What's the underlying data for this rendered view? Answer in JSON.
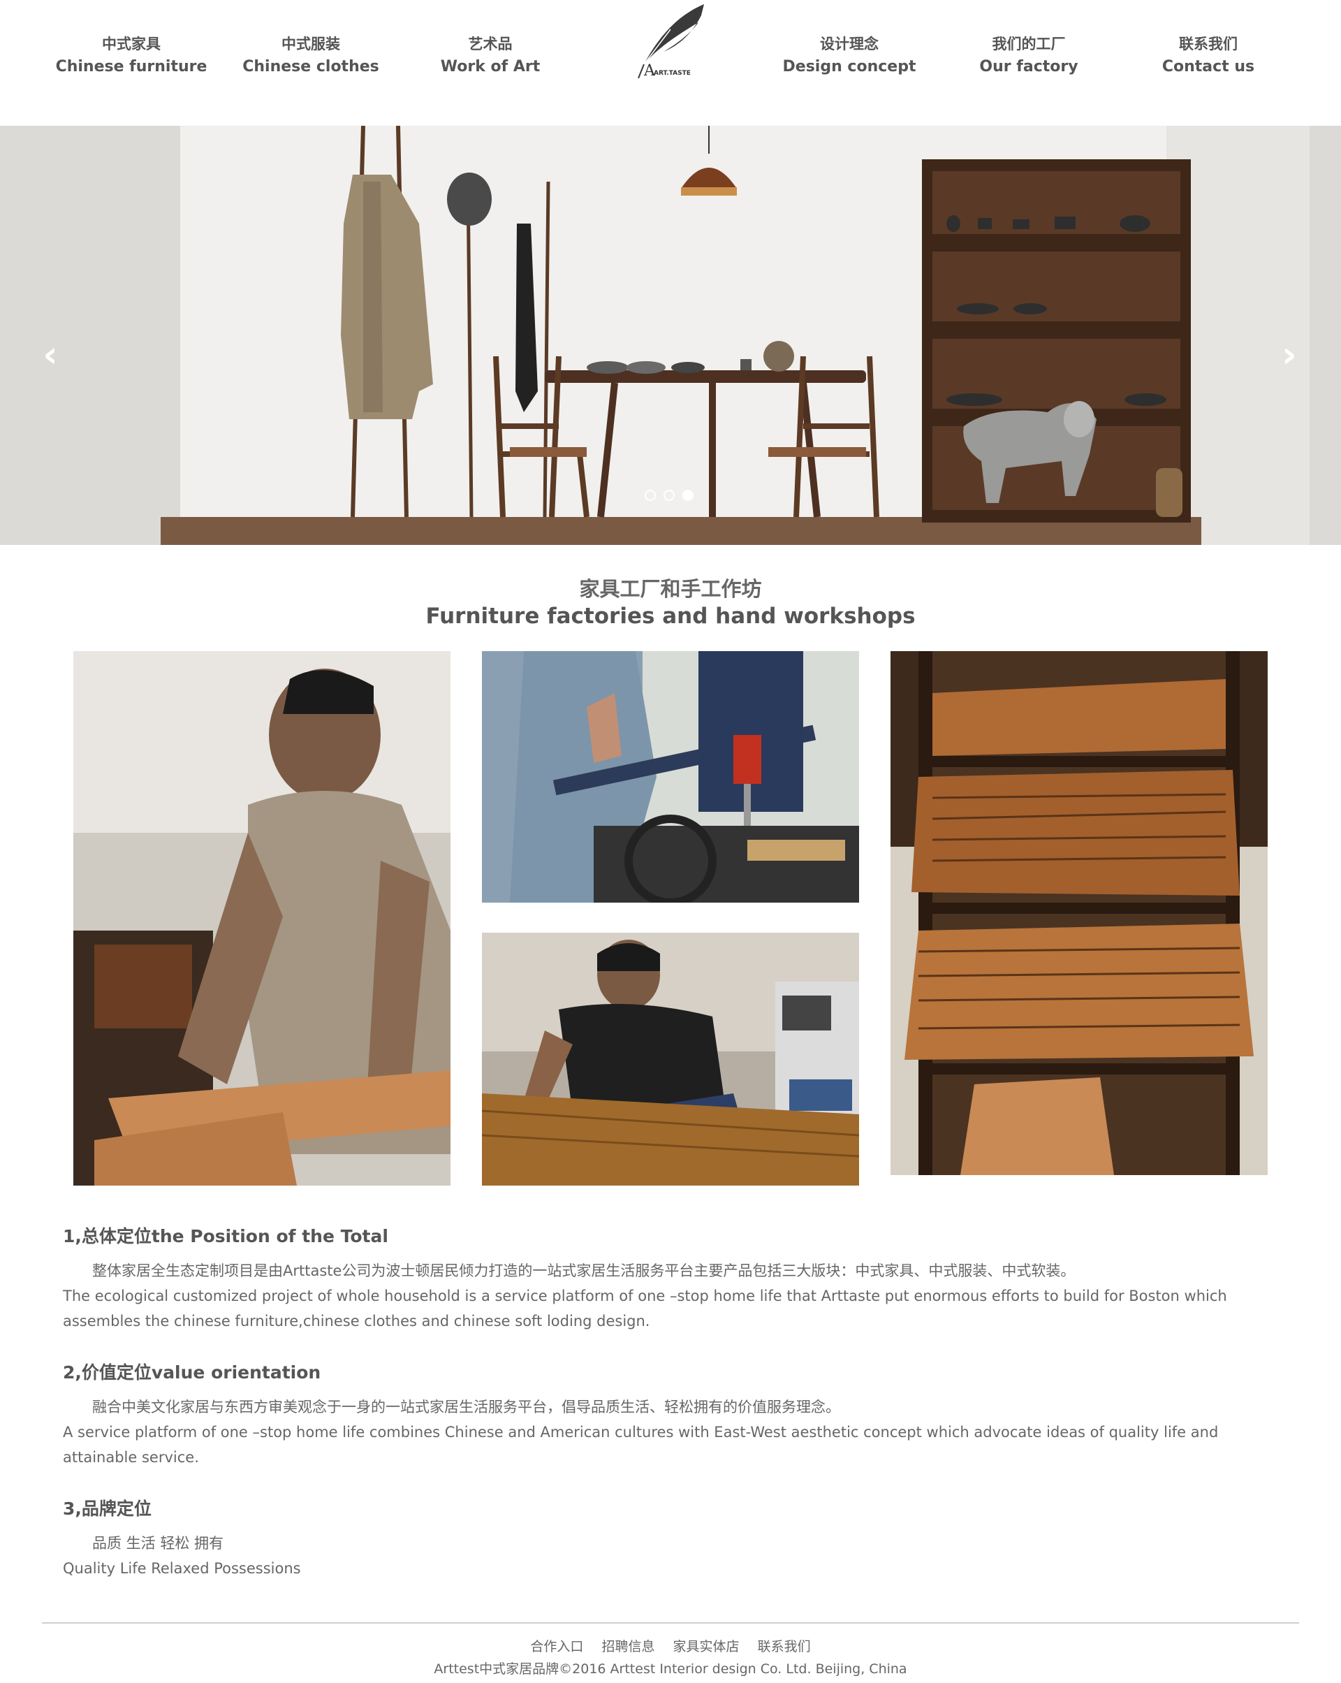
{
  "nav": {
    "left": [
      {
        "cn": "中式家具",
        "en": "Chinese furniture"
      },
      {
        "cn": "中式服装",
        "en": "Chinese clothes"
      },
      {
        "cn": "艺术品",
        "en": "Work of Art"
      }
    ],
    "right": [
      {
        "cn": "设计理念",
        "en": "Design concept"
      },
      {
        "cn": "我们的工厂",
        "en": "Our factory"
      },
      {
        "cn": "联系我们",
        "en": "Contact us"
      }
    ],
    "logo_text": "ART.TASTE"
  },
  "banner": {
    "prev_icon": "chevron-left-icon",
    "next_icon": "chevron-right-icon",
    "prev_glyph": "‹",
    "next_glyph": "›",
    "slide_count": 3,
    "active_slide": 3
  },
  "section": {
    "title_cn": "家具工厂和手工作坊",
    "title_en": "Furniture factories and hand workshops"
  },
  "articles": [
    {
      "heading": "1,总体定位the Position of the Total",
      "cn": "整体家居全生态定制项目是由Arttaste公司为波士顿居民倾力打造的一站式家居生活服务平台主要产品包括三大版块：中式家具、中式服装、中式软装。",
      "en": "The ecological customized project of whole household is a service platform of one –stop home life that Arttaste put enormous efforts to build for Boston which assembles the chinese furniture,chinese clothes and chinese soft loding design."
    },
    {
      "heading": "2,价值定位value orientation",
      "cn": "融合中美文化家居与东西方审美观念于一身的一站式家居生活服务平台，倡导品质生活、轻松拥有的价值服务理念。",
      "en": "A service platform of one –stop home life combines Chinese and American cultures with East-West aesthetic concept which advocate ideas of quality life and attainable service."
    },
    {
      "heading": "3,品牌定位",
      "cn": "品质 生活 轻松 拥有",
      "en": "Quality Life Relaxed Possessions"
    }
  ],
  "footer": {
    "links": [
      "合作入口",
      "招聘信息",
      "家具实体店",
      "联系我们"
    ],
    "copyright": "Arttest中式家居品牌©2016 Arttest Interior design Co. Ltd. Beijing, China"
  },
  "colors": {
    "text": "#555555",
    "wall": "#eceae6",
    "wood": "#6b4a32",
    "divider": "#cfcfcf"
  }
}
